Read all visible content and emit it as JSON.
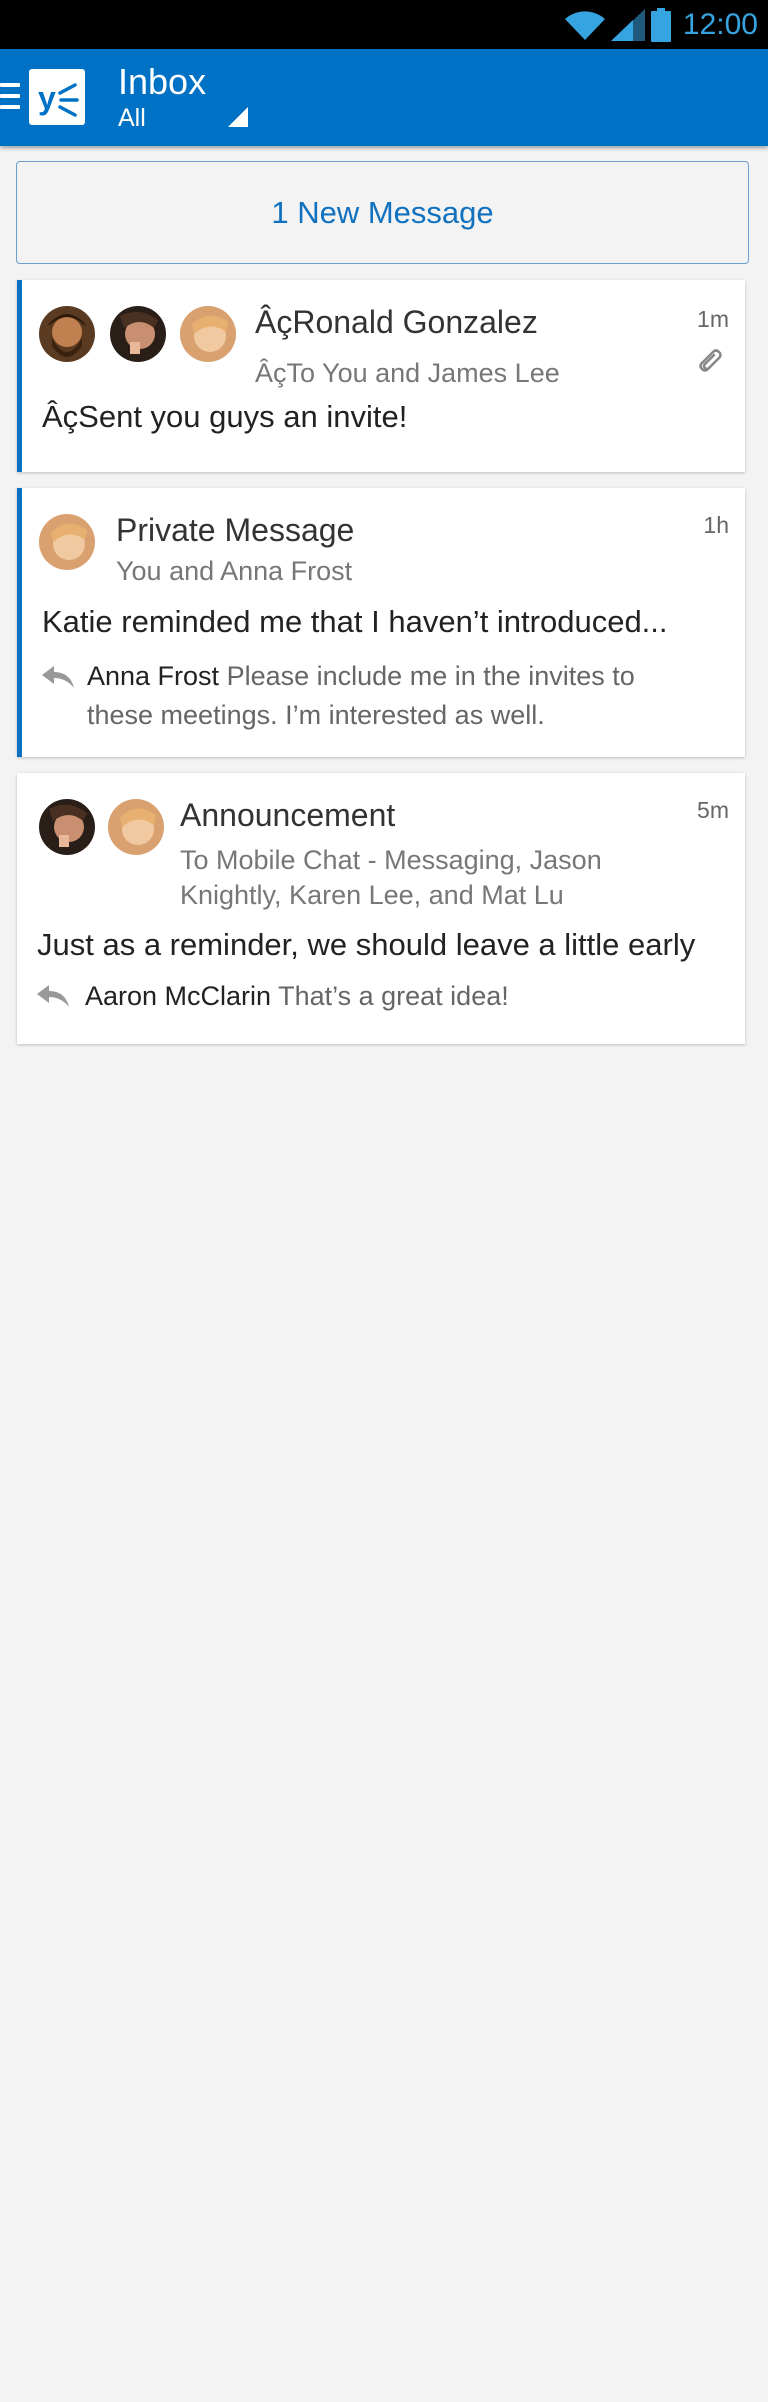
{
  "status_bar": {
    "time": "12:00",
    "icons": [
      "wifi-icon",
      "signal-icon",
      "battery-icon"
    ],
    "accent": "#36a4e0"
  },
  "app_bar": {
    "title": "Inbox",
    "filter": "All",
    "color": "#0072c6"
  },
  "new_message_banner": "1 New Message",
  "threads": [
    {
      "name": "ÂçRonald Gonzalez",
      "recipients": "ÂçTo You and James Lee",
      "time": "1m",
      "preview": "ÂçSent you guys an invite!",
      "has_attachment": true,
      "unread": true,
      "avatars": [
        "avatar-man-beard",
        "avatar-man-dark",
        "avatar-woman-blonde"
      ]
    },
    {
      "name": "Private Message",
      "recipients": "You and Anna Frost",
      "time": "1h",
      "preview": "Katie reminded me that I haven’t introduced...",
      "unread": true,
      "avatars": [
        "avatar-woman-blonde"
      ],
      "reply": {
        "author": "Anna Frost",
        "text": "Please include me in the invites to these meetings. I’m interested as well."
      }
    },
    {
      "name": "Announcement",
      "recipients": "To Mobile Chat - Messaging, Jason Knightly, Karen Lee, and Mat Lu",
      "time": "5m",
      "preview": "Just as a reminder, we should leave a little early",
      "unread": false,
      "avatars": [
        "avatar-man-dark",
        "avatar-woman-blonde"
      ],
      "reply": {
        "author": "Aaron McClarin",
        "text": "That’s a great idea!"
      }
    }
  ]
}
